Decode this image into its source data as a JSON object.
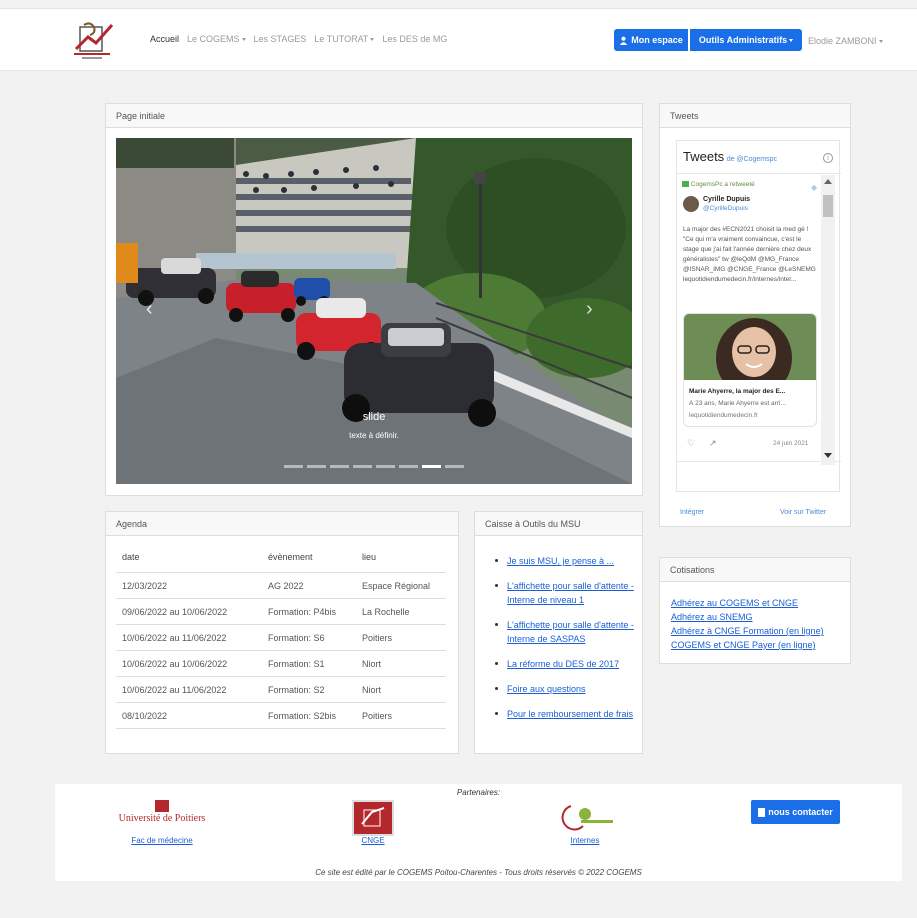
{
  "navbar": {
    "items": [
      {
        "label": "Accueil",
        "dropdown": false
      },
      {
        "label": "Le COGEMS",
        "dropdown": true
      },
      {
        "label": "Les STAGES",
        "dropdown": false
      },
      {
        "label": "Le TUTORAT",
        "dropdown": true
      },
      {
        "label": "Les DES de MG",
        "dropdown": false
      }
    ],
    "espace_label": "Mon espace",
    "outils_label": "Outils Administratifs",
    "user_label": "Elodie ZAMBONI"
  },
  "home_card": {
    "title": "Page initiale",
    "slide_title": "slide",
    "slide_text": "texte à définir.",
    "slide_count": 8,
    "active_slide": 6
  },
  "agenda": {
    "title": "Agenda",
    "columns": [
      "date",
      "évènement",
      "lieu"
    ],
    "rows": [
      [
        "12/03/2022",
        "AG 2022",
        "Espace Régional"
      ],
      [
        "09/06/2022 au 10/06/2022",
        "Formation: P4bis",
        "La Rochelle"
      ],
      [
        "10/06/2022 au 11/06/2022",
        "Formation: S6",
        "Poitiers"
      ],
      [
        "10/06/2022 au 10/06/2022",
        "Formation: S1",
        "Niort"
      ],
      [
        "10/06/2022 au 11/06/2022",
        "Formation: S2",
        "Niort"
      ],
      [
        "08/10/2022",
        "Formation: S2bis",
        "Poitiers"
      ]
    ]
  },
  "toolbox": {
    "title": "Caisse à Outils du MSU",
    "links": [
      "Je suis MSU, je pense à ...",
      "L'affichette pour salle d'attente - Interne de niveau 1",
      "L'affichette pour salle d'attente - Interne de SASPAS",
      "La réforme du DES de 2017",
      "Foire aux questions",
      "Pour le remboursement de frais"
    ]
  },
  "tweets": {
    "title": "Tweets",
    "widget_title": "Tweets",
    "widget_by": "de @Cogemspc",
    "retweet_note": "CogemsPc a retweeté",
    "author_name": "Cyrille Dupuis",
    "author_handle": "@CyrilleDupuis",
    "tweet_text": "La major des #ECN2021 choisit la med gé ! \"Ce qui m'a vraiment convaincue, c'est le stage que j'ai fait l'année dernière chez deux généralistes\" tw @leQdM @MG_France @ISNAR_IMG @CNGE_France @LeSNEMG lequotidiendumedecin.fr/internes/inter...",
    "card_title": "Marie Ahyerre, la major des E...",
    "card_text": "À 23 ans, Marie Ahyerre est arri...",
    "card_domain": "lequotidiendumedecin.fr",
    "tweet_date": "24 juin 2021",
    "embed_label": "Intégrer",
    "view_label": "Voir sur Twitter"
  },
  "cotisations": {
    "title": "Cotisations",
    "links": [
      "Adhérez au COGEMS et CNGE",
      "Adhérez au SNEMG",
      "Adhérez à CNGE Formation (en ligne)",
      "COGEMS et CNGE Payer (en ligne)"
    ]
  },
  "footer": {
    "partners_title": "Partenaires:",
    "univ_logo_text": "Université de Poitiers",
    "partners": [
      "Fac de médecine",
      "CNGE",
      "Internes"
    ],
    "contact_label": "nous contacter",
    "copyright": "Ce site est édité par le COGEMS Poitou-Charentes - Tous droits réservés © 2022 COGEMS"
  },
  "colors": {
    "accent": "#1a6fe8",
    "link": "#1a5fd6",
    "brand_red": "#b3282d"
  }
}
